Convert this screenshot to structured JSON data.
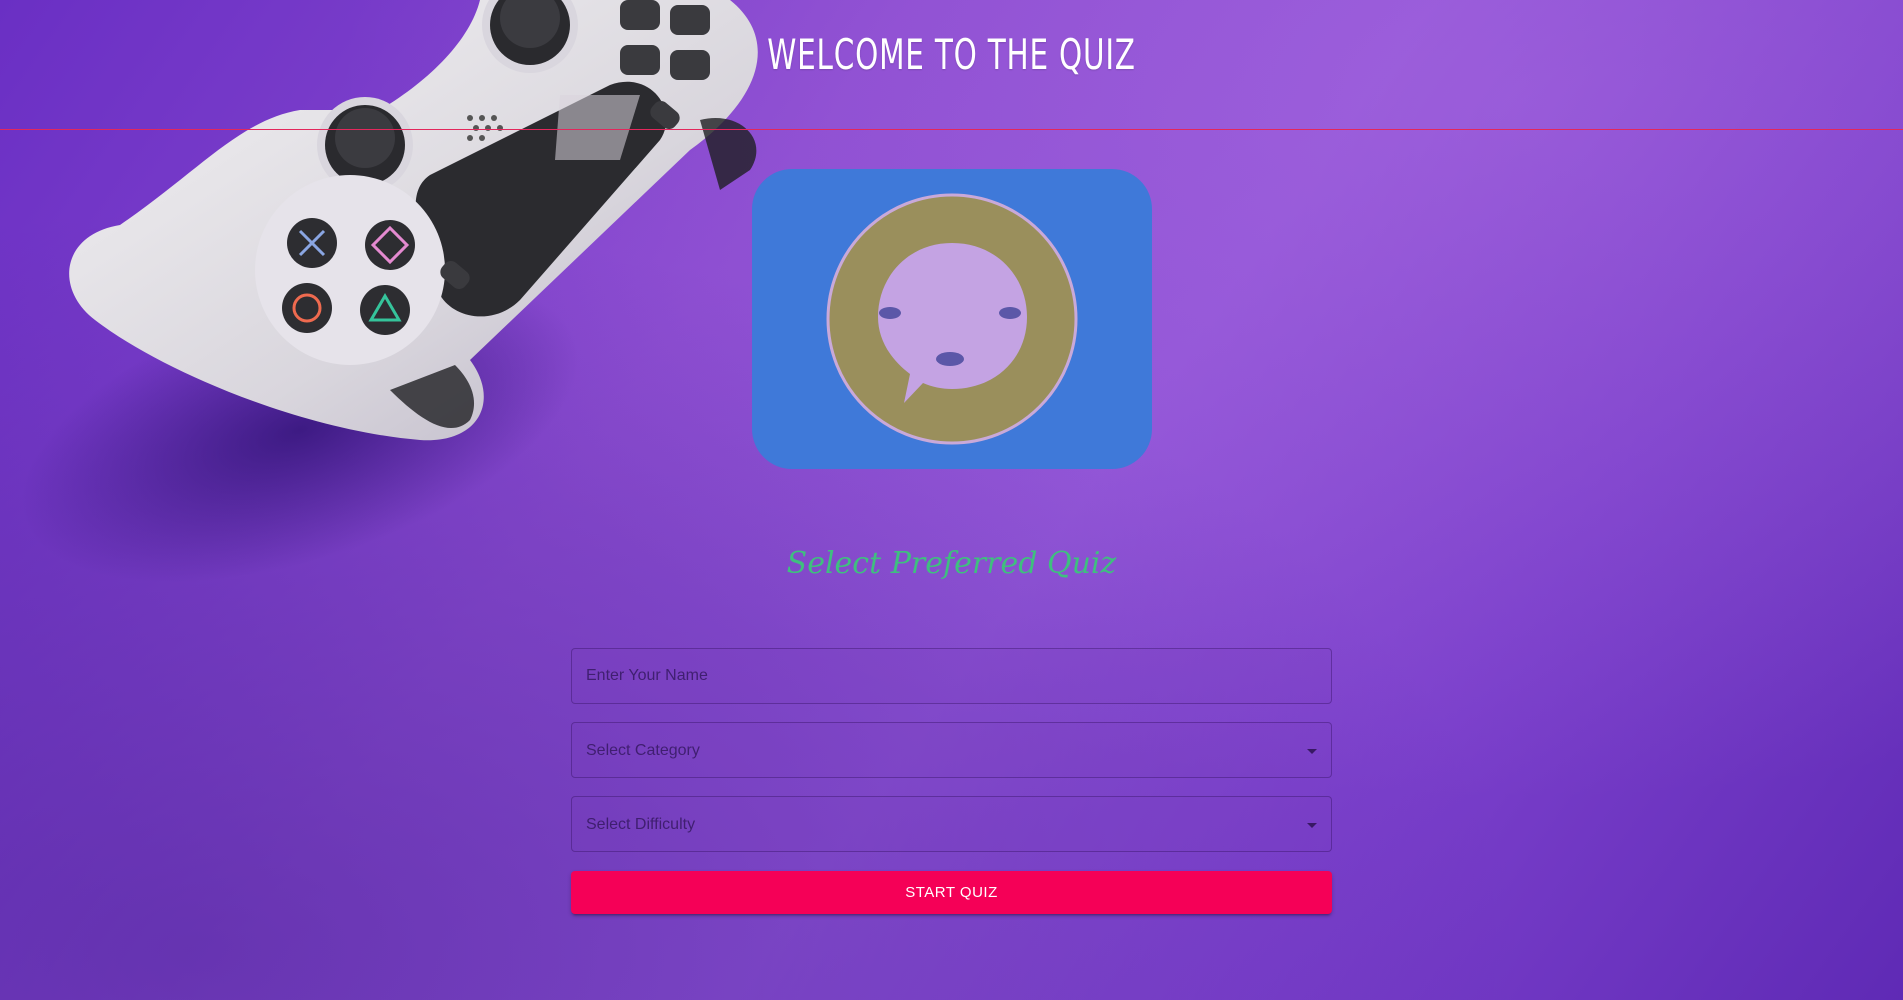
{
  "header": {
    "title": "WELCOME TO THE QUIZ"
  },
  "logo": {
    "icon": "chat-face-icon",
    "card_color": "#3f79d9",
    "ring_color": "#9a8f5c",
    "face_color": "#c4a3e3",
    "feature_color": "#5b57a8"
  },
  "main": {
    "subtitle": "Select Preferred Quiz"
  },
  "form": {
    "name_placeholder": "Enter Your Name",
    "name_value": "",
    "category_label": "Select Category",
    "difficulty_label": "Select Difficulty",
    "start_label": "START QUIZ"
  },
  "colors": {
    "accent": "#f50057",
    "subtitle": "#3fbf7f",
    "divider": "#e3275c",
    "background": "#8a4bd0"
  },
  "background": {
    "image": "gamepad-controller"
  }
}
